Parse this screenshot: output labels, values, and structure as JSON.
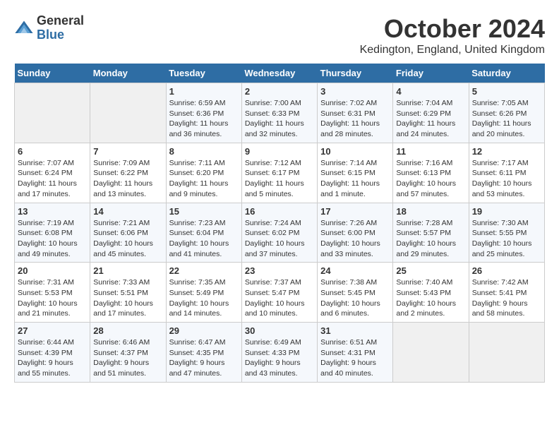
{
  "header": {
    "logo_line1": "General",
    "logo_line2": "Blue",
    "month": "October 2024",
    "location": "Kedington, England, United Kingdom"
  },
  "weekdays": [
    "Sunday",
    "Monday",
    "Tuesday",
    "Wednesday",
    "Thursday",
    "Friday",
    "Saturday"
  ],
  "weeks": [
    [
      {
        "day": "",
        "sunrise": "",
        "sunset": "",
        "daylight": ""
      },
      {
        "day": "",
        "sunrise": "",
        "sunset": "",
        "daylight": ""
      },
      {
        "day": "1",
        "sunrise": "Sunrise: 6:59 AM",
        "sunset": "Sunset: 6:36 PM",
        "daylight": "Daylight: 11 hours and 36 minutes."
      },
      {
        "day": "2",
        "sunrise": "Sunrise: 7:00 AM",
        "sunset": "Sunset: 6:33 PM",
        "daylight": "Daylight: 11 hours and 32 minutes."
      },
      {
        "day": "3",
        "sunrise": "Sunrise: 7:02 AM",
        "sunset": "Sunset: 6:31 PM",
        "daylight": "Daylight: 11 hours and 28 minutes."
      },
      {
        "day": "4",
        "sunrise": "Sunrise: 7:04 AM",
        "sunset": "Sunset: 6:29 PM",
        "daylight": "Daylight: 11 hours and 24 minutes."
      },
      {
        "day": "5",
        "sunrise": "Sunrise: 7:05 AM",
        "sunset": "Sunset: 6:26 PM",
        "daylight": "Daylight: 11 hours and 20 minutes."
      }
    ],
    [
      {
        "day": "6",
        "sunrise": "Sunrise: 7:07 AM",
        "sunset": "Sunset: 6:24 PM",
        "daylight": "Daylight: 11 hours and 17 minutes."
      },
      {
        "day": "7",
        "sunrise": "Sunrise: 7:09 AM",
        "sunset": "Sunset: 6:22 PM",
        "daylight": "Daylight: 11 hours and 13 minutes."
      },
      {
        "day": "8",
        "sunrise": "Sunrise: 7:11 AM",
        "sunset": "Sunset: 6:20 PM",
        "daylight": "Daylight: 11 hours and 9 minutes."
      },
      {
        "day": "9",
        "sunrise": "Sunrise: 7:12 AM",
        "sunset": "Sunset: 6:17 PM",
        "daylight": "Daylight: 11 hours and 5 minutes."
      },
      {
        "day": "10",
        "sunrise": "Sunrise: 7:14 AM",
        "sunset": "Sunset: 6:15 PM",
        "daylight": "Daylight: 11 hours and 1 minute."
      },
      {
        "day": "11",
        "sunrise": "Sunrise: 7:16 AM",
        "sunset": "Sunset: 6:13 PM",
        "daylight": "Daylight: 10 hours and 57 minutes."
      },
      {
        "day": "12",
        "sunrise": "Sunrise: 7:17 AM",
        "sunset": "Sunset: 6:11 PM",
        "daylight": "Daylight: 10 hours and 53 minutes."
      }
    ],
    [
      {
        "day": "13",
        "sunrise": "Sunrise: 7:19 AM",
        "sunset": "Sunset: 6:08 PM",
        "daylight": "Daylight: 10 hours and 49 minutes."
      },
      {
        "day": "14",
        "sunrise": "Sunrise: 7:21 AM",
        "sunset": "Sunset: 6:06 PM",
        "daylight": "Daylight: 10 hours and 45 minutes."
      },
      {
        "day": "15",
        "sunrise": "Sunrise: 7:23 AM",
        "sunset": "Sunset: 6:04 PM",
        "daylight": "Daylight: 10 hours and 41 minutes."
      },
      {
        "day": "16",
        "sunrise": "Sunrise: 7:24 AM",
        "sunset": "Sunset: 6:02 PM",
        "daylight": "Daylight: 10 hours and 37 minutes."
      },
      {
        "day": "17",
        "sunrise": "Sunrise: 7:26 AM",
        "sunset": "Sunset: 6:00 PM",
        "daylight": "Daylight: 10 hours and 33 minutes."
      },
      {
        "day": "18",
        "sunrise": "Sunrise: 7:28 AM",
        "sunset": "Sunset: 5:57 PM",
        "daylight": "Daylight: 10 hours and 29 minutes."
      },
      {
        "day": "19",
        "sunrise": "Sunrise: 7:30 AM",
        "sunset": "Sunset: 5:55 PM",
        "daylight": "Daylight: 10 hours and 25 minutes."
      }
    ],
    [
      {
        "day": "20",
        "sunrise": "Sunrise: 7:31 AM",
        "sunset": "Sunset: 5:53 PM",
        "daylight": "Daylight: 10 hours and 21 minutes."
      },
      {
        "day": "21",
        "sunrise": "Sunrise: 7:33 AM",
        "sunset": "Sunset: 5:51 PM",
        "daylight": "Daylight: 10 hours and 17 minutes."
      },
      {
        "day": "22",
        "sunrise": "Sunrise: 7:35 AM",
        "sunset": "Sunset: 5:49 PM",
        "daylight": "Daylight: 10 hours and 14 minutes."
      },
      {
        "day": "23",
        "sunrise": "Sunrise: 7:37 AM",
        "sunset": "Sunset: 5:47 PM",
        "daylight": "Daylight: 10 hours and 10 minutes."
      },
      {
        "day": "24",
        "sunrise": "Sunrise: 7:38 AM",
        "sunset": "Sunset: 5:45 PM",
        "daylight": "Daylight: 10 hours and 6 minutes."
      },
      {
        "day": "25",
        "sunrise": "Sunrise: 7:40 AM",
        "sunset": "Sunset: 5:43 PM",
        "daylight": "Daylight: 10 hours and 2 minutes."
      },
      {
        "day": "26",
        "sunrise": "Sunrise: 7:42 AM",
        "sunset": "Sunset: 5:41 PM",
        "daylight": "Daylight: 9 hours and 58 minutes."
      }
    ],
    [
      {
        "day": "27",
        "sunrise": "Sunrise: 6:44 AM",
        "sunset": "Sunset: 4:39 PM",
        "daylight": "Daylight: 9 hours and 55 minutes."
      },
      {
        "day": "28",
        "sunrise": "Sunrise: 6:46 AM",
        "sunset": "Sunset: 4:37 PM",
        "daylight": "Daylight: 9 hours and 51 minutes."
      },
      {
        "day": "29",
        "sunrise": "Sunrise: 6:47 AM",
        "sunset": "Sunset: 4:35 PM",
        "daylight": "Daylight: 9 hours and 47 minutes."
      },
      {
        "day": "30",
        "sunrise": "Sunrise: 6:49 AM",
        "sunset": "Sunset: 4:33 PM",
        "daylight": "Daylight: 9 hours and 43 minutes."
      },
      {
        "day": "31",
        "sunrise": "Sunrise: 6:51 AM",
        "sunset": "Sunset: 4:31 PM",
        "daylight": "Daylight: 9 hours and 40 minutes."
      },
      {
        "day": "",
        "sunrise": "",
        "sunset": "",
        "daylight": ""
      },
      {
        "day": "",
        "sunrise": "",
        "sunset": "",
        "daylight": ""
      }
    ]
  ]
}
